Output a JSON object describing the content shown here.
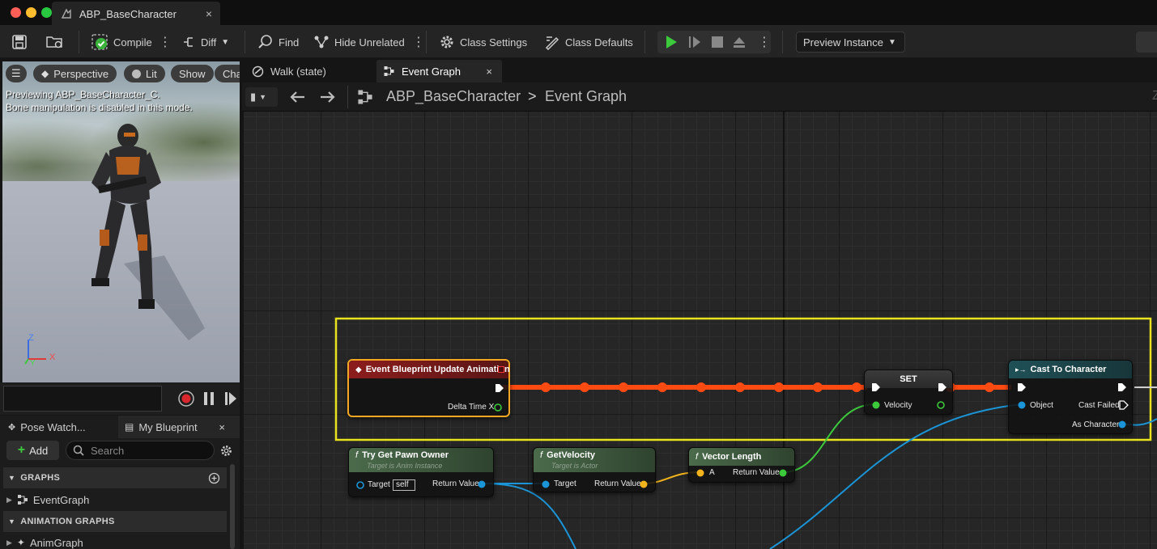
{
  "window": {
    "tab_title": "ABP_BaseCharacter",
    "tab_close": "×"
  },
  "toolbar": {
    "compile": "Compile",
    "diff": "Diff",
    "find": "Find",
    "hide_unrelated": "Hide Unrelated",
    "class_settings": "Class Settings",
    "class_defaults": "Class Defaults",
    "preview_instance": "Preview Instance"
  },
  "viewport": {
    "perspective": "Perspective",
    "lit": "Lit",
    "show": "Show",
    "character": "Char",
    "previewing": "Previewing ABP_BaseCharacter_C.",
    "bone_notice": "Bone manipulation is disabled in this mode.",
    "axis_z": "Z",
    "axis_x": "X",
    "axis_y": "Y"
  },
  "left_panel": {
    "tab_pose_watch": "Pose Watch...",
    "tab_my_blueprint": "My Blueprint",
    "tab_close": "×",
    "add_label": "Add",
    "search_placeholder": "Search",
    "section_graphs": "GRAPHS",
    "item_event_graph": "EventGraph",
    "section_anim_graphs": "ANIMATION GRAPHS",
    "item_anim_graph": "AnimGraph"
  },
  "graph_tabs": [
    {
      "label": "Walk (state)"
    },
    {
      "label": "Event Graph",
      "close": "×"
    }
  ],
  "breadcrumb": {
    "root": "ABP_BaseCharacter",
    "separator": ">",
    "current": "Event Graph",
    "zoom": "Z"
  },
  "nodes": {
    "event_update": {
      "title": "Event Blueprint Update Animation",
      "pin_out": "Delta Time X"
    },
    "set": {
      "title": "SET",
      "pin_in": "Velocity"
    },
    "cast": {
      "title": "Cast To Character",
      "pin_object": "Object",
      "pin_failed": "Cast Failed",
      "pin_as": "As Character"
    },
    "pawn_owner": {
      "title": "Try Get Pawn Owner",
      "subtitle": "Target is Anim Instance",
      "pin_target": "Target",
      "self": "self",
      "pin_return": "Return Value"
    },
    "get_velocity": {
      "title": "GetVelocity",
      "subtitle": "Target is Actor",
      "pin_target": "Target",
      "pin_return": "Return Value"
    },
    "vector_length": {
      "title": "Vector Length",
      "pin_a": "A",
      "pin_return": "Return Value"
    }
  },
  "colors": {
    "highlight_box": "#e9e21f",
    "exec_wire": "#ff4a12",
    "object_wire": "#1a95d8",
    "vector_wire": "#f2b31d",
    "float_wire": "#3cc93c",
    "event_header": "#8c1d1d",
    "function_header": "#3f5b3f",
    "cast_header": "#1f5157"
  }
}
